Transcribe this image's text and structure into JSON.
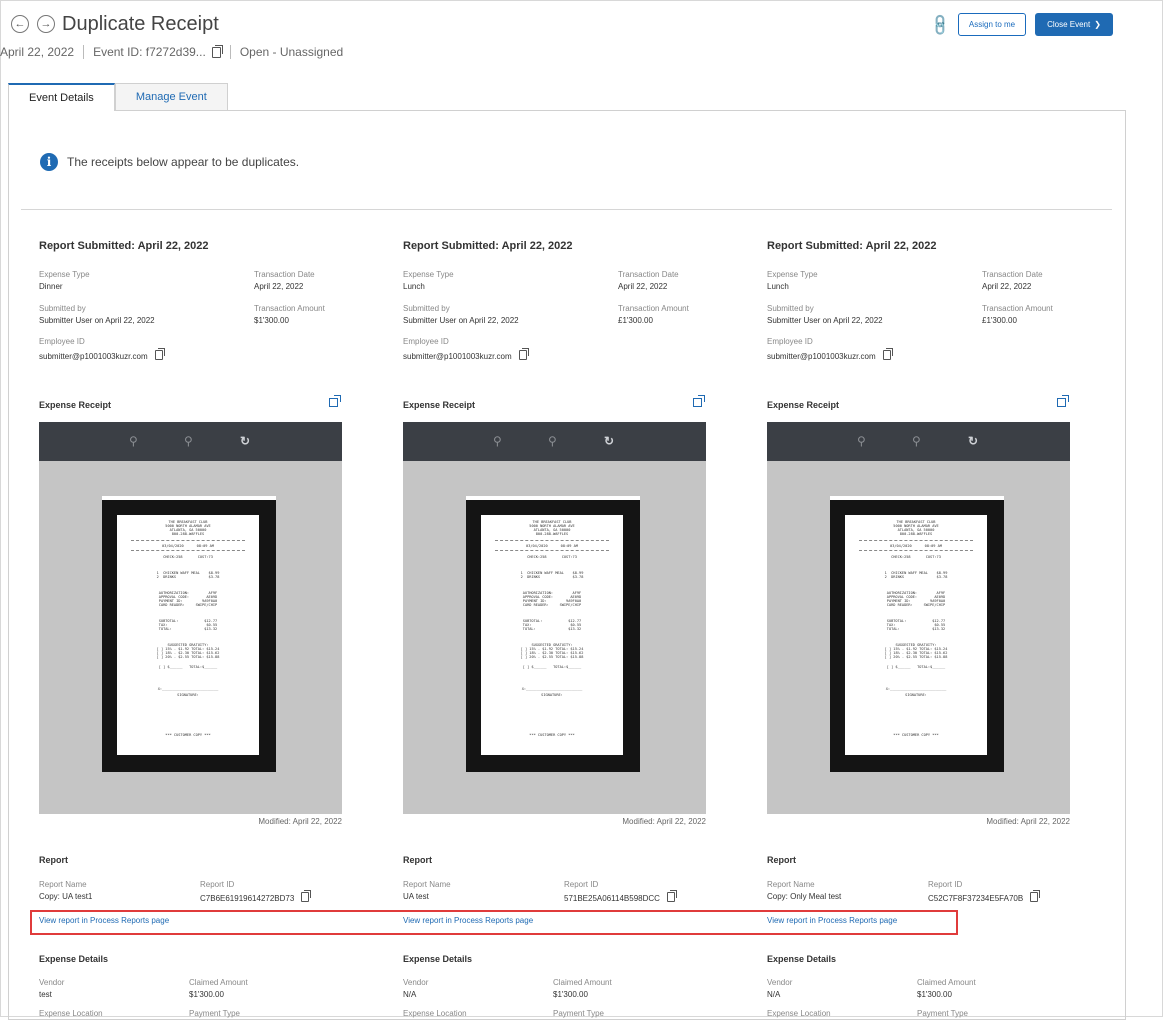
{
  "header": {
    "title": "Duplicate Receipt",
    "date": "April 22, 2022",
    "event_id": "Event ID: f7272d39...",
    "status": "Open - Unassigned",
    "assign_label": "Assign to me",
    "close_label": "Close Event"
  },
  "tabs": [
    {
      "label": "Event Details",
      "active": true
    },
    {
      "label": "Manage Event",
      "active": false
    }
  ],
  "notice": "The receipts below appear to be duplicates.",
  "labels": {
    "expense_type": "Expense Type",
    "transaction_date": "Transaction Date",
    "submitted_by": "Submitted by",
    "transaction_amount": "Transaction Amount",
    "employee_id": "Employee ID",
    "expense_receipt": "Expense Receipt",
    "report": "Report",
    "report_name": "Report Name",
    "report_id": "Report ID",
    "view_report": "View report in Process Reports page",
    "expense_details": "Expense Details",
    "vendor": "Vendor",
    "claimed_amount": "Claimed Amount",
    "expense_location": "Expense Location",
    "payment_type": "Payment Type"
  },
  "receipt_text": {
    "l1": "THE BREAKFAST CLUB",
    "l2": "5000 NORTH ALAMAR AVE",
    "l3": "ATLANTA, GA 50000",
    "l4": "800-288-WAFFLES",
    "l5": "03/04/2020      08:09 AM",
    "l6": "CHECK:258       CUST:73",
    "l7": "1  CHICKEN WAFF MEAL    $8.99",
    "l8": "2  DRINKS               $3.78",
    "l9": "AUTHORIZATION:         AF9F",
    "l10": "APPROVAL CODE:        AE09D",
    "l11": "PAYMENT ID:         9A9F0A0",
    "l12": "CARD READER:     SWIPE/CHIP",
    "l13": "SUBTOTAL:            $12.77",
    "l14": "TAX:                  $0.55",
    "l15": "TOTAL:               $13.32",
    "l16": "SUGGESTED GRATUITY:",
    "l17": "[ ] 15% - $1.92 TOTAL: $15.24",
    "l18": "[ ] 18% - $2.30 TOTAL: $15.62",
    "l19": "[ ] 20% - $2.55 TOTAL: $15.88",
    "l20": "[ ] $______   TOTAL:$______",
    "l21": "X:__________________________",
    "l22": "SIGNATURE:",
    "l23": "*** CUSTOMER COPY ***"
  },
  "reports": [
    {
      "title": "Report Submitted: April 22, 2022",
      "expense_type": "Dinner",
      "transaction_date": "April 22, 2022",
      "submitted_by": "Submitter User on April 22, 2022",
      "transaction_amount": "$1'300.00",
      "employee_id": "submitter@p1001003kuzr.com",
      "modified": "Modified: April 22, 2022",
      "report_name": "Copy: UA test1",
      "report_id": "C7B6E61919614272BD73",
      "vendor": "test",
      "claimed_amount": "$1'300.00"
    },
    {
      "title": "Report Submitted: April 22, 2022",
      "expense_type": "Lunch",
      "transaction_date": "April 22, 2022",
      "submitted_by": "Submitter User on April 22, 2022",
      "transaction_amount": "£1'300.00",
      "employee_id": "submitter@p1001003kuzr.com",
      "modified": "Modified: April 22, 2022",
      "report_name": "UA test",
      "report_id": "571BE25A06114B598DCC",
      "vendor": "N/A",
      "claimed_amount": "$1'300.00"
    },
    {
      "title": "Report Submitted: April 22, 2022",
      "expense_type": "Lunch",
      "transaction_date": "April 22, 2022",
      "submitted_by": "Submitter User on April 22, 2022",
      "transaction_amount": "£1'300.00",
      "employee_id": "submitter@p1001003kuzr.com",
      "modified": "Modified: April 22, 2022",
      "report_name": "Copy: Only Meal test",
      "report_id": "C52C7F8F37234E5FA70B",
      "vendor": "N/A",
      "claimed_amount": "$1'300.00"
    }
  ],
  "colors": {
    "accent": "#1f6ab3",
    "highlight": "#e03b3b"
  },
  "icons": [
    "back-arrow-icon",
    "forward-arrow-icon",
    "copy-icon",
    "link-icon",
    "chevron-down-icon",
    "info-icon",
    "external-link-icon",
    "zoom-in-icon",
    "zoom-out-icon",
    "rotate-icon"
  ]
}
